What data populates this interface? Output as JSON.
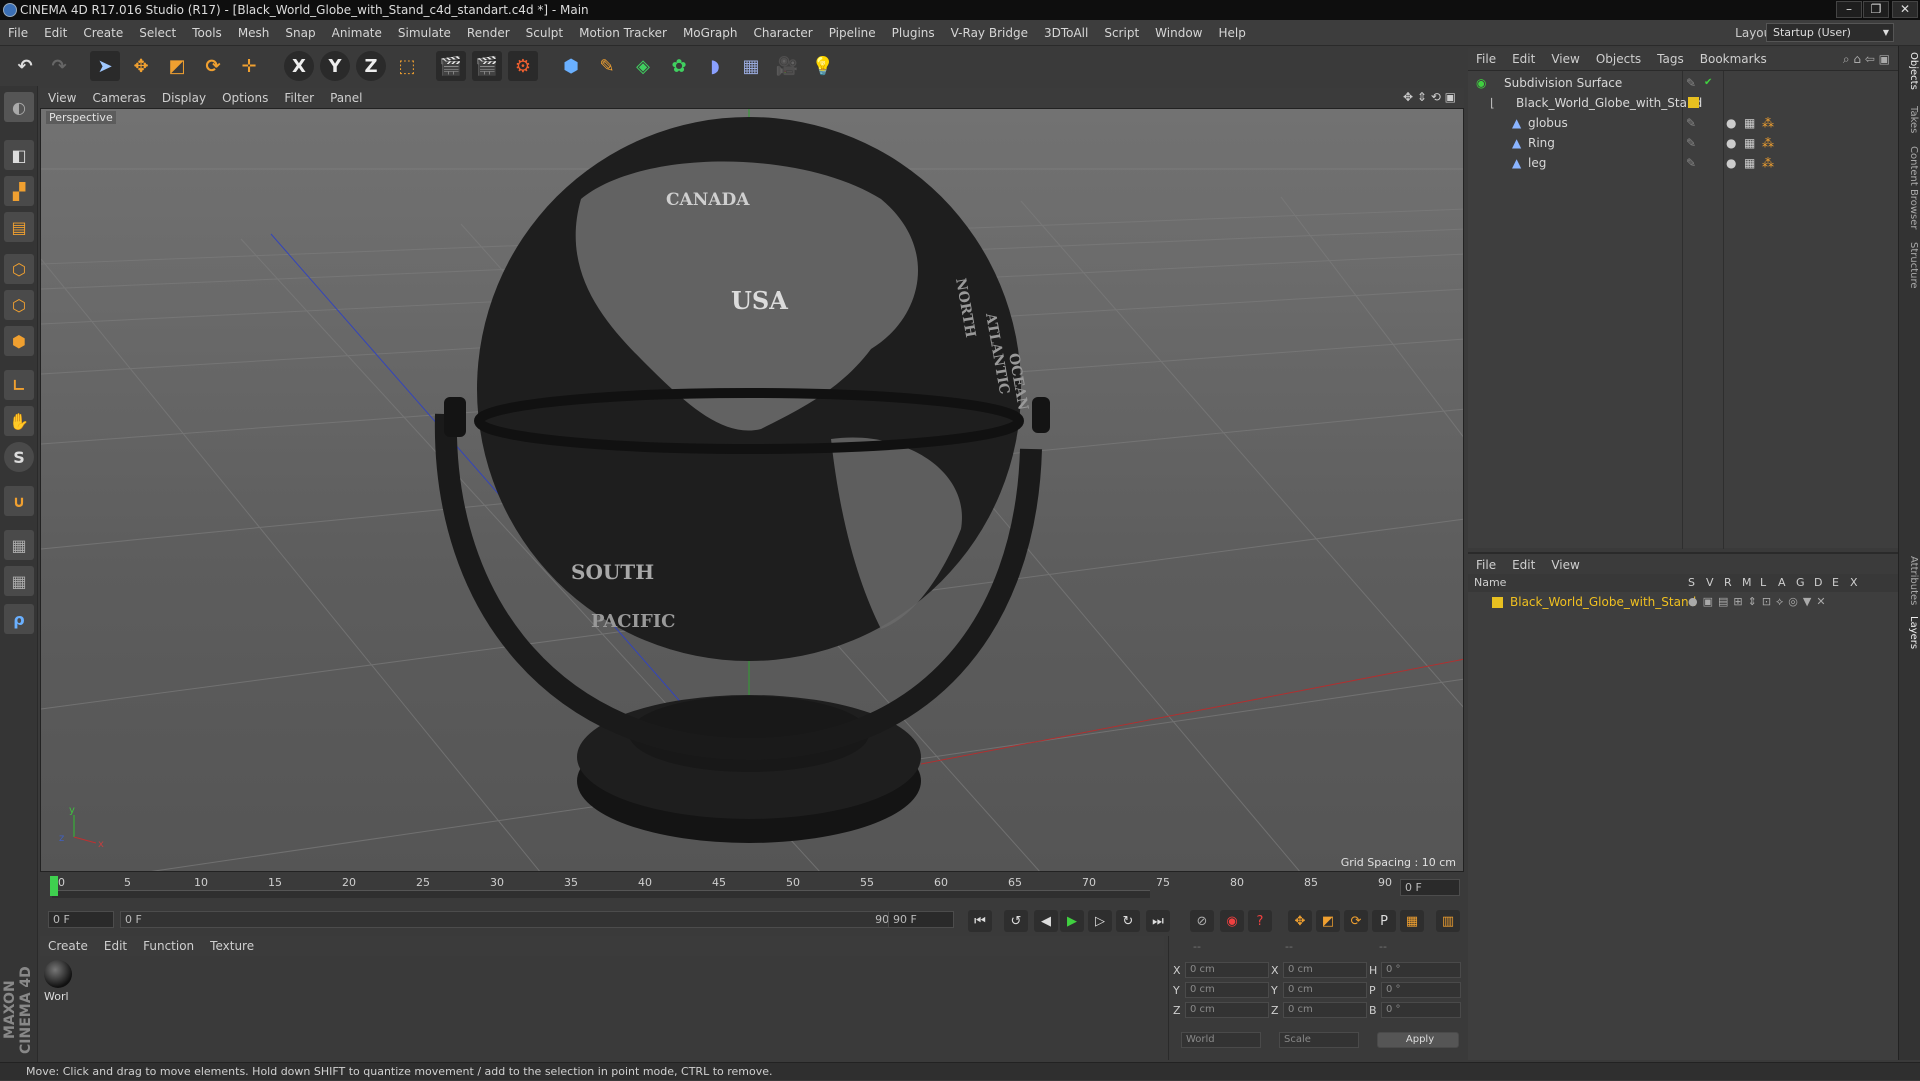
{
  "window": {
    "title": "CINEMA 4D R17.016 Studio (R17) - [Black_World_Globe_with_Stand_c4d_standart.c4d *] - Main",
    "minimize": "–",
    "restore": "❐",
    "close": "✕"
  },
  "menu": [
    "File",
    "Edit",
    "Create",
    "Select",
    "Tools",
    "Mesh",
    "Snap",
    "Animate",
    "Simulate",
    "Render",
    "Sculpt",
    "Motion Tracker",
    "MoGraph",
    "Character",
    "Pipeline",
    "Plugins",
    "V-Ray Bridge",
    "3DToAll",
    "Script",
    "Window",
    "Help"
  ],
  "layout": {
    "label": "Layout:",
    "value": "Startup (User)"
  },
  "toolbar": {
    "x_label": "X",
    "y_label": "Y",
    "z_label": "Z"
  },
  "viewport": {
    "menu": [
      "View",
      "Cameras",
      "Display",
      "Options",
      "Filter",
      "Panel"
    ],
    "label": "Perspective",
    "grid_spacing": "Grid Spacing : 10 cm",
    "globe_labels": [
      "CANADA",
      "USA",
      "SOUTH",
      "PACIFIC",
      "NORTH",
      "ATLANTIC",
      "OCEAN"
    ],
    "axis_y": "y",
    "axis_x": "x",
    "axis_z": "z"
  },
  "timeline": {
    "ticks": [
      "0",
      "5",
      "10",
      "15",
      "20",
      "25",
      "30",
      "35",
      "40",
      "45",
      "50",
      "55",
      "60",
      "65",
      "70",
      "75",
      "80",
      "85",
      "90"
    ],
    "current_frame": "0 F",
    "start_field": "0 F",
    "range_start": "0 F",
    "range_end": "90 F",
    "end_field": "90 F"
  },
  "material": {
    "menu": [
      "Create",
      "Edit",
      "Function",
      "Texture"
    ],
    "item_label": "Worl"
  },
  "coordinates": {
    "header": [
      "--",
      "--",
      "--"
    ],
    "rows": [
      {
        "a": "X",
        "av": "0 cm",
        "b": "X",
        "bv": "0 cm",
        "c": "H",
        "cv": "0 °"
      },
      {
        "a": "Y",
        "av": "0 cm",
        "b": "Y",
        "bv": "0 cm",
        "c": "P",
        "cv": "0 °"
      },
      {
        "a": "Z",
        "av": "0 cm",
        "b": "Z",
        "bv": "0 cm",
        "c": "B",
        "cv": "0 °"
      }
    ],
    "world": "World",
    "scale": "Scale",
    "apply": "Apply"
  },
  "objects": {
    "menu": [
      "File",
      "Edit",
      "View",
      "Objects",
      "Tags",
      "Bookmarks"
    ],
    "tree": [
      {
        "name": "Subdivision Surface"
      },
      {
        "name": "Black_World_Globe_with_Stand"
      },
      {
        "name": "globus"
      },
      {
        "name": "Ring"
      },
      {
        "name": "leg"
      }
    ]
  },
  "layers": {
    "menu": [
      "File",
      "Edit",
      "View"
    ],
    "header_name": "Name",
    "header_cols": [
      "S",
      "V",
      "R",
      "M",
      "L",
      "A",
      "G",
      "D",
      "E",
      "X"
    ],
    "row_name": "Black_World_Globe_with_Stand"
  },
  "side_tabs": [
    "Objects",
    "Takes",
    "Content Browser",
    "Structure",
    "Attributes",
    "Layers"
  ],
  "maxon": "MAXON CINEMA 4D",
  "status": "Move: Click and drag to move elements. Hold down SHIFT to quantize movement / add to the selection in point mode, CTRL to remove.",
  "colors": {
    "accent_orange": "#f0a030",
    "layer_yellow": "#e8c020",
    "active_blue": "#3b6fb5"
  }
}
